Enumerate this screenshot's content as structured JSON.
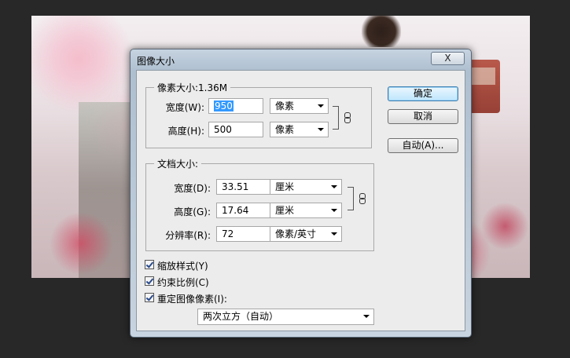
{
  "dialog": {
    "title": "图像大小",
    "close_label": "X"
  },
  "pixel_dimensions": {
    "legend": "像素大小:1.36M",
    "width_label": "宽度(W):",
    "width_value": "950",
    "width_unit": "像素",
    "height_label": "高度(H):",
    "height_value": "500",
    "height_unit": "像素"
  },
  "document_size": {
    "legend": "文档大小:",
    "width_label": "宽度(D):",
    "width_value": "33.51",
    "width_unit": "厘米",
    "height_label": "高度(G):",
    "height_value": "17.64",
    "height_unit": "厘米",
    "resolution_label": "分辨率(R):",
    "resolution_value": "72",
    "resolution_unit": "像素/英寸"
  },
  "buttons": {
    "ok": "确定",
    "cancel": "取消",
    "auto": "自动(A)..."
  },
  "options": {
    "scale_styles": "缩放样式(Y)",
    "constrain_proportions": "约束比例(C)",
    "resample_image": "重定图像像素(I):",
    "resample_method": "两次立方（自动）"
  },
  "icons": {
    "link_chain": "chain-link-icon",
    "dropdown": "chevron-down-icon",
    "check": "checkmark-icon"
  },
  "colors": {
    "selection": "#3399ff",
    "default_button": "#bee6fd"
  }
}
